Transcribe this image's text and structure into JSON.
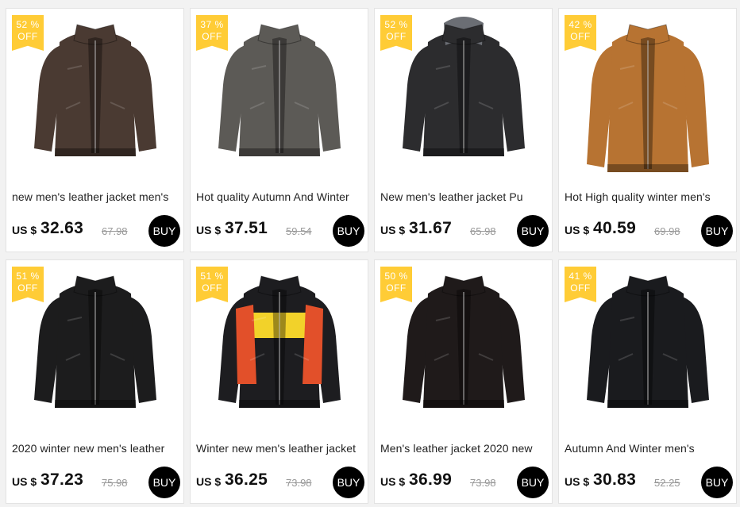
{
  "currency_label": "US $",
  "buy_label": "BUY",
  "products": [
    {
      "discount": "52 %",
      "off": "OFF",
      "title": "new men's leather jacket men's",
      "price": "32.63",
      "old_price": "67.98",
      "color": "#4a3a32",
      "style": "collar"
    },
    {
      "discount": "37 %",
      "off": "OFF",
      "title": "Hot quality Autumn And Winter",
      "price": "37.51",
      "old_price": "59.54",
      "color": "#5c5a56",
      "style": "stand"
    },
    {
      "discount": "52 %",
      "off": "OFF",
      "title": "New men's leather jacket Pu",
      "price": "31.67",
      "old_price": "65.98",
      "color": "#2c2c2e",
      "style": "hood"
    },
    {
      "discount": "42 %",
      "off": "OFF",
      "title": "Hot High quality winter men's",
      "price": "40.59",
      "old_price": "69.98",
      "color": "#b77332",
      "style": "long"
    },
    {
      "discount": "51 %",
      "off": "OFF",
      "title": "2020 winter new men's leather",
      "price": "37.23",
      "old_price": "75.98",
      "color": "#1c1c1d",
      "style": "biker"
    },
    {
      "discount": "51 %",
      "off": "OFF",
      "title": "Winter new men's leather jacket",
      "price": "36.25",
      "old_price": "73.98",
      "color": "#1d1d20",
      "style": "racer"
    },
    {
      "discount": "50 %",
      "off": "OFF",
      "title": "Men's leather jacket 2020 new",
      "price": "36.99",
      "old_price": "73.98",
      "color": "#1f1a1a",
      "style": "stand"
    },
    {
      "discount": "41 %",
      "off": "OFF",
      "title": "Autumn And Winter men's",
      "price": "30.83",
      "old_price": "52.25",
      "color": "#1a1b1e",
      "style": "collar"
    }
  ]
}
